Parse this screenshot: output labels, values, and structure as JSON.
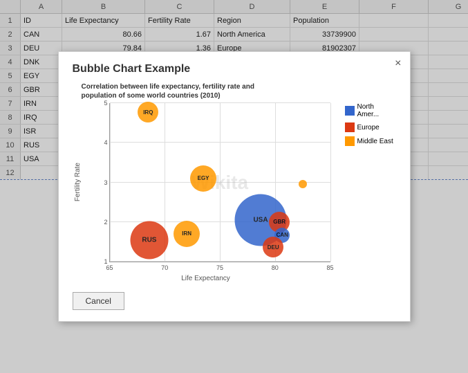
{
  "spreadsheet": {
    "columns": [
      "A",
      "B",
      "C",
      "D",
      "E",
      "F",
      "G"
    ],
    "headers": {
      "a": "A",
      "b": "B",
      "c": "C",
      "d": "D",
      "e": "E",
      "f": "F",
      "g": "G"
    },
    "rows": [
      {
        "num": "1",
        "a": "ID",
        "b": "Life Expectancy",
        "c": "Fertility Rate",
        "d": "Region",
        "e": "Population",
        "f": "",
        "g": ""
      },
      {
        "num": "2",
        "a": "CAN",
        "b": "80.66",
        "c": "1.67",
        "d": "North America",
        "e": "33739900",
        "f": "",
        "g": ""
      },
      {
        "num": "3",
        "a": "DEU",
        "b": "79.84",
        "c": "1.36",
        "d": "Europe",
        "e": "81902307",
        "f": "",
        "g": ""
      },
      {
        "num": "4",
        "a": "DNK",
        "b": "",
        "c": "",
        "d": "",
        "e": "",
        "f": "",
        "g": ""
      },
      {
        "num": "5",
        "a": "EGY",
        "b": "",
        "c": "",
        "d": "",
        "e": "",
        "f": "",
        "g": ""
      },
      {
        "num": "6",
        "a": "GBR",
        "b": "",
        "c": "",
        "d": "",
        "e": "",
        "f": "",
        "g": ""
      },
      {
        "num": "7",
        "a": "IRN",
        "b": "",
        "c": "",
        "d": "",
        "e": "",
        "f": "",
        "g": ""
      },
      {
        "num": "8",
        "a": "IRQ",
        "b": "",
        "c": "",
        "d": "",
        "e": "",
        "f": "",
        "g": ""
      },
      {
        "num": "9",
        "a": "ISR",
        "b": "",
        "c": "",
        "d": "",
        "e": "",
        "f": "",
        "g": ""
      },
      {
        "num": "10",
        "a": "RUS",
        "b": "",
        "c": "",
        "d": "",
        "e": "",
        "f": "",
        "g": ""
      },
      {
        "num": "11",
        "a": "USA",
        "b": "",
        "c": "",
        "d": "",
        "e": "",
        "f": "",
        "g": ""
      },
      {
        "num": "12",
        "a": "",
        "b": "",
        "c": "",
        "d": "",
        "e": "",
        "f": "",
        "g": ""
      }
    ]
  },
  "modal": {
    "title": "Bubble Chart Example",
    "close_label": "×",
    "chart_title": "Correlation between life expectancy, fertility rate and population of some world countries (2010)",
    "x_axis_label": "Life Expectancy",
    "y_axis_label": "Fertility Rate",
    "cancel_label": "Cancel",
    "watermark": "Wikita",
    "y_ticks": [
      "1",
      "2",
      "3",
      "4",
      "5"
    ],
    "x_ticks": [
      "65",
      "70",
      "75",
      "80",
      "85"
    ],
    "legend": [
      {
        "label": "North Amer...",
        "color": "#3366cc"
      },
      {
        "label": "Europe",
        "color": "#dc3912"
      },
      {
        "label": "Middle East",
        "color": "#ff9900"
      }
    ],
    "bubbles": [
      {
        "id": "IRQ",
        "x": 68.5,
        "y": 4.77,
        "size": 30,
        "color": "#ff9900",
        "label": "IRQ"
      },
      {
        "id": "EGY",
        "x": 73.5,
        "y": 3.1,
        "size": 38,
        "color": "#ff9900",
        "label": "EGY"
      },
      {
        "id": "RUS",
        "x": 68.6,
        "y": 1.54,
        "size": 55,
        "color": "#dc3912",
        "label": "RUS"
      },
      {
        "id": "IRN",
        "x": 72.0,
        "y": 1.7,
        "size": 38,
        "color": "#ff9900",
        "label": "IRN"
      },
      {
        "id": "USA",
        "x": 78.7,
        "y": 2.05,
        "size": 75,
        "color": "#3366cc",
        "label": "USA"
      },
      {
        "id": "GBR",
        "x": 80.4,
        "y": 2.0,
        "size": 30,
        "color": "#dc3912",
        "label": "GBR"
      },
      {
        "id": "CAN",
        "x": 80.66,
        "y": 1.67,
        "size": 22,
        "color": "#3366cc",
        "label": "CAN"
      },
      {
        "id": "DEU",
        "x": 79.84,
        "y": 1.36,
        "size": 30,
        "color": "#dc3912",
        "label": "DEU"
      },
      {
        "id": "ISR",
        "x": 82.5,
        "y": 2.95,
        "size": 12,
        "color": "#ff9900",
        "label": ""
      }
    ]
  }
}
